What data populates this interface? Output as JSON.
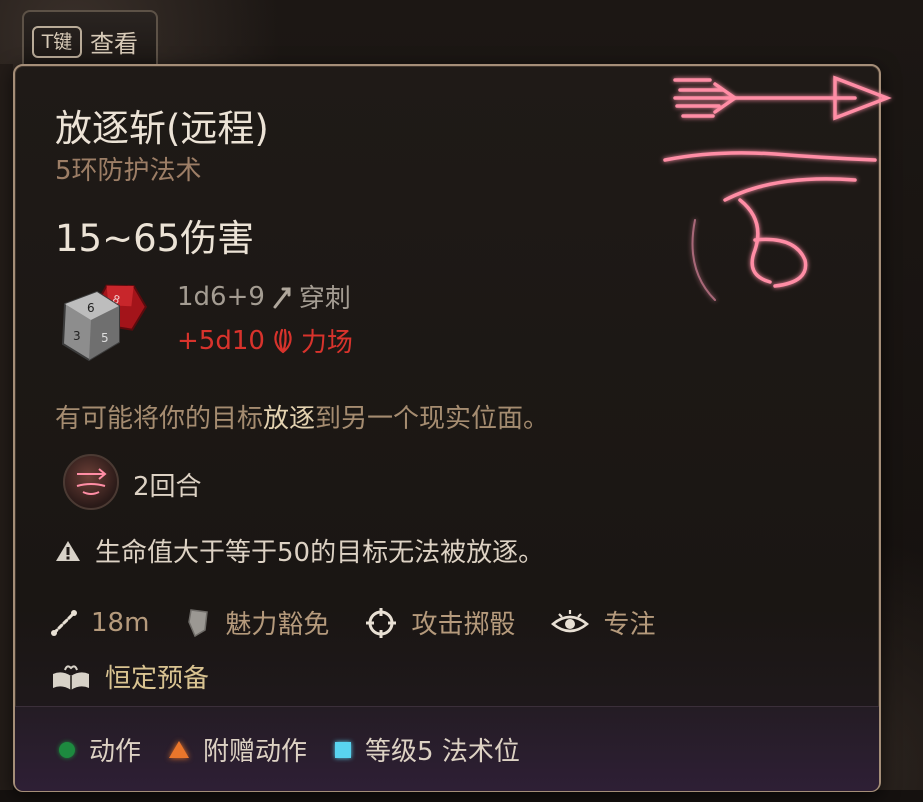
{
  "hotkey": {
    "key": "T键",
    "label": "查看"
  },
  "spell": {
    "name": "放逐斩(远程)",
    "school": "5环防护法术",
    "damage_range": "15~65伤害",
    "damage_lines": [
      {
        "dice": "1d6+9",
        "type": "穿刺",
        "icon": "piercing-arrow-icon",
        "color": "#a49c92"
      },
      {
        "dice": "+5d10",
        "type": "力场",
        "icon": "force-hand-icon",
        "color": "#d8332c"
      }
    ],
    "description_pre": "有可能将你的目标",
    "description_highlight": "放逐",
    "description_post": "到另一个现实位面。",
    "duration": "2回合",
    "warning": "生命值大于等于50的目标无法被放逐。",
    "properties": [
      {
        "icon": "range-icon",
        "label": "18m"
      },
      {
        "icon": "shield-save-icon",
        "label": "魅力豁免"
      },
      {
        "icon": "crosshair-icon",
        "label": "攻击掷骰"
      },
      {
        "icon": "concentration-eye-icon",
        "label": "专注"
      }
    ],
    "ritual": "恒定预备"
  },
  "costs": [
    {
      "icon": "action-dot-icon",
      "label": "动作",
      "color": "#1d8a3f"
    },
    {
      "icon": "bonus-action-triangle-icon",
      "label": "附赠动作",
      "color": "#e9762b"
    },
    {
      "icon": "spell-slot-square-icon",
      "label": "等级5 法术位",
      "color": "#59d4f0"
    }
  ],
  "colors": {
    "border": "#a58e78",
    "accent_red": "#d8332c",
    "neon_pink": "#ff7f9e"
  }
}
